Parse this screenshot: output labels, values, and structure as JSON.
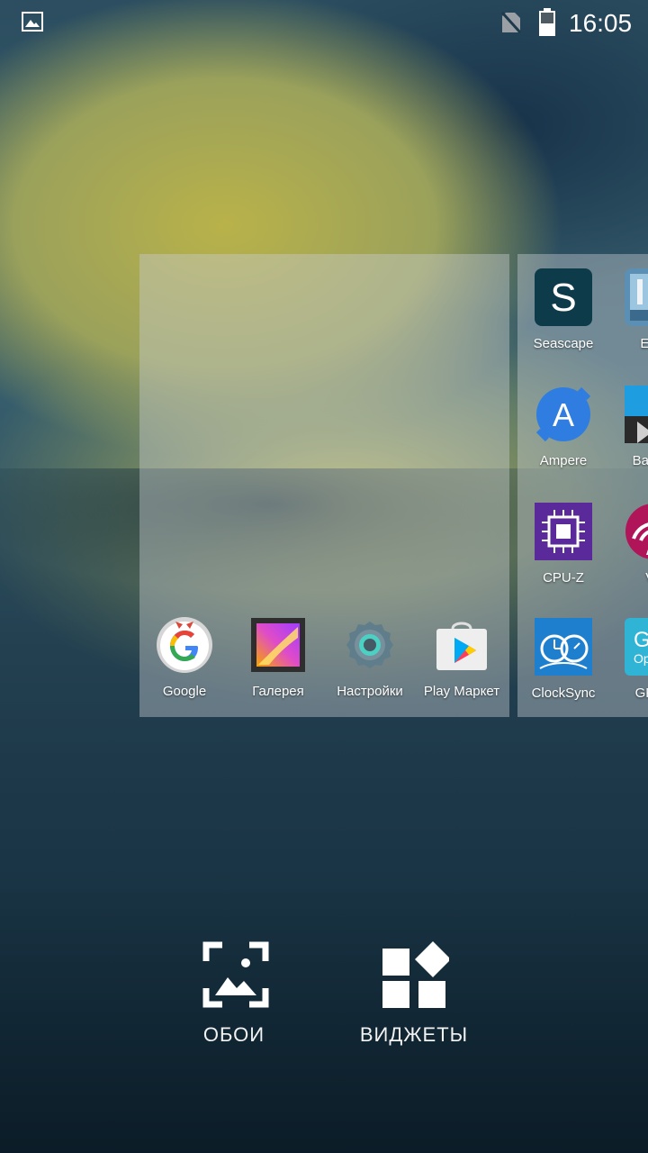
{
  "status_bar": {
    "time": "16:05",
    "icons": [
      "gallery-icon",
      "no-sim-icon",
      "battery-icon"
    ]
  },
  "workspace": {
    "current_page": {
      "dock_apps": [
        {
          "label": "Google",
          "icon": "google-icon"
        },
        {
          "label": "Галерея",
          "icon": "gallery-icon"
        },
        {
          "label": "Настройки",
          "icon": "settings-icon"
        },
        {
          "label": "Play Маркет",
          "icon": "play-market-icon"
        }
      ]
    },
    "next_page": {
      "apps": [
        {
          "label": "Seascape",
          "icon": "seascape-icon"
        },
        {
          "label": "Epic",
          "icon": "epic-citadel-icon"
        },
        {
          "label": "Ampere",
          "icon": "ampere-icon"
        },
        {
          "label": "Basem",
          "icon": "basemark-icon"
        },
        {
          "label": "CPU-Z",
          "icon": "cpu-z-icon"
        },
        {
          "label": "Ve",
          "icon": "vellamo-icon"
        },
        {
          "label": "ClockSync",
          "icon": "clocksync-icon"
        },
        {
          "label": "GFXB",
          "icon": "gfxbench-icon"
        }
      ]
    }
  },
  "options": {
    "wallpapers_label": "ОБОИ",
    "widgets_label": "ВИДЖЕТЫ"
  },
  "colors": {
    "seascape": "#0d3b4a",
    "ampere": "#2f7de1",
    "cpu_z": "#5b2a9a",
    "clocksync": "#1f7fcf",
    "page_overlay": "#c8cdd2"
  }
}
